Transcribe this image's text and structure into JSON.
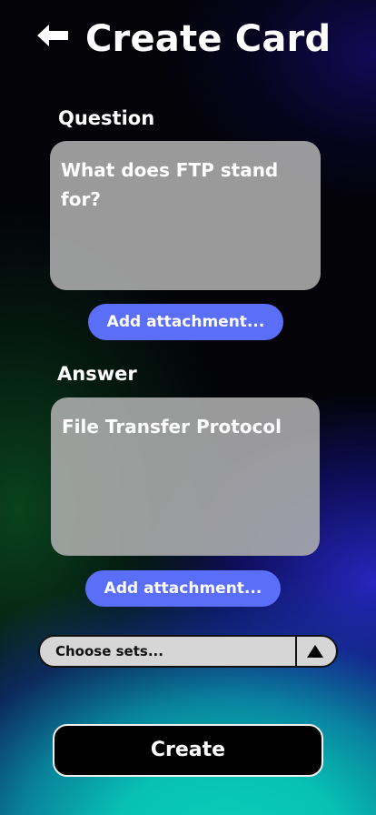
{
  "header": {
    "title": "Create Card",
    "back_icon": "left-arrow-icon"
  },
  "question": {
    "label": "Question",
    "value": "What does FTP stand for?",
    "attach_label": "Add attachment..."
  },
  "answer": {
    "label": "Answer",
    "value": "File Transfer Protocol",
    "attach_label": "Add attachment..."
  },
  "sets": {
    "selected": "Choose sets...",
    "arrow_icon": "triangle-up-icon"
  },
  "create_label": "Create",
  "colors": {
    "accent": "#5a6ef8",
    "field_bg": "#afafaf",
    "select_bg": "#d6d6d6"
  }
}
